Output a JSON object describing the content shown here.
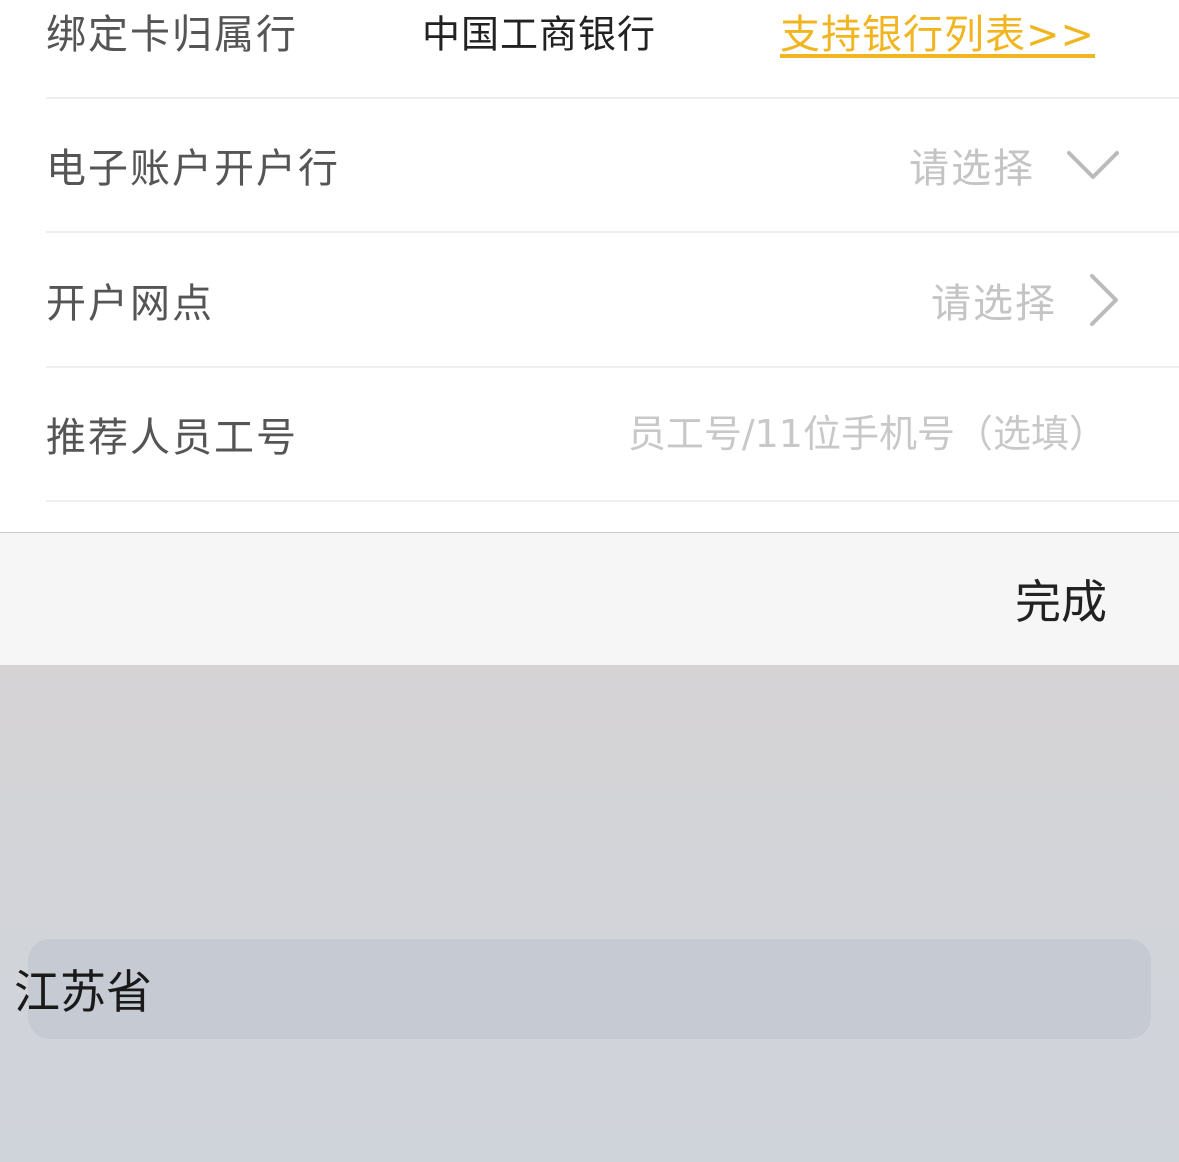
{
  "form": {
    "rows": [
      {
        "label": "绑定卡归属行",
        "value": "中国工商银行",
        "link": "支持银行列表>>"
      },
      {
        "label": "电子账户开户行",
        "placeholder": "请选择"
      },
      {
        "label": "开户网点",
        "placeholder": "请选择"
      },
      {
        "label": "推荐人员工号",
        "input_placeholder": "员工号/11位手机号（选填）"
      }
    ]
  },
  "picker": {
    "done_label": "完成",
    "selected_option": "江苏省"
  },
  "icons": {
    "dropdown": "chevron-down-icon",
    "disclosure": "chevron-right-icon"
  },
  "colors": {
    "link": "#f1b520",
    "placeholder": "#c4c4c4",
    "label": "#555555"
  }
}
